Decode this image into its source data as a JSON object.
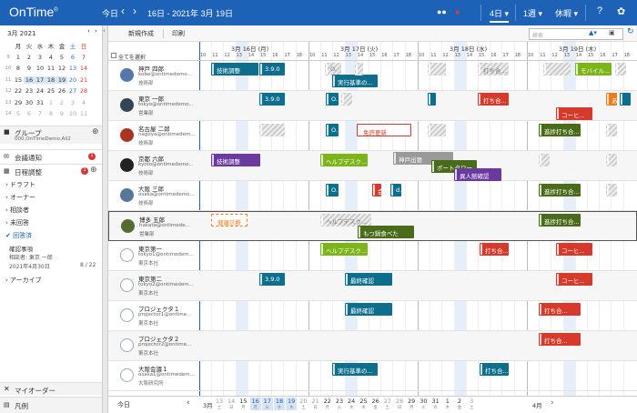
{
  "app": {
    "logo": "OnTime",
    "reg": "®"
  },
  "topbar": {
    "today": "今日",
    "prev": "‹",
    "next": "›",
    "date": "16日 - 2021年 3月 19日",
    "days": "4日",
    "week": "1週",
    "rest": "休暇",
    "help": "?",
    "gear": "✿"
  },
  "toolbar": {
    "new": "新規作成",
    "print": "印刷",
    "search_placeholder": "検索"
  },
  "calendar": {
    "title": "3月 2021",
    "weekdays": [
      "月",
      "火",
      "水",
      "木",
      "金",
      "土",
      "日"
    ],
    "rows": [
      {
        "wk": "9",
        "d": [
          "1",
          "2",
          "3",
          "4",
          "5",
          "6",
          "7"
        ]
      },
      {
        "wk": "10",
        "d": [
          "8",
          "9",
          "10",
          "11",
          "12",
          "13",
          "14"
        ]
      },
      {
        "wk": "11",
        "d": [
          "15",
          "16",
          "17",
          "18",
          "19",
          "20",
          "21"
        ]
      },
      {
        "wk": "12",
        "d": [
          "22",
          "23",
          "24",
          "25",
          "26",
          "27",
          "28"
        ]
      },
      {
        "wk": "13",
        "d": [
          "29",
          "30",
          "31",
          "1",
          "2",
          "3",
          "4"
        ]
      },
      {
        "wk": "14",
        "d": [
          "5",
          "6",
          "7",
          "8",
          "9",
          "10",
          "11"
        ]
      }
    ]
  },
  "left": {
    "group": "グループ",
    "group_sub": "000.OnTimeDemo.All2",
    "notice": "会議通知",
    "notice_badge": "1",
    "schedule": "日程調整",
    "schedule_badge": "1",
    "draft": "ドラフト",
    "owner": "オーナー",
    "consult": "相談者",
    "unanswered": "未回答",
    "answered": "回答済",
    "confirm": "確認事項",
    "consult_by": "相談者: 東京 一郎",
    "confirm_date": "2021年4月30日",
    "confirm_count": "8 / 22",
    "archive": "アーカイブ",
    "my_order": "マイオーダー",
    "legend": "凡例"
  },
  "grid": {
    "select_all": "全てを選択",
    "days": [
      "3月 16日 (月)",
      "3月 17日 (火)",
      "3月 18日 (水)",
      "3月 19日 (木)"
    ],
    "hours": [
      "10",
      "11",
      "12",
      "13",
      "14",
      "15",
      "16",
      "17",
      "18"
    ]
  },
  "people": [
    {
      "name": "神戸 四郎",
      "mail": "kobe@ontimedemo...",
      "dept": "技術部"
    },
    {
      "name": "東京 一郎",
      "mail": "tokyo@ontimedemo...",
      "dept": "営業部"
    },
    {
      "name": "名古屋 二郎",
      "mail": "nagoya@ontimedem...",
      "dept": "技術部"
    },
    {
      "name": "京都 六郎",
      "mail": "kyoto@ontimedemo...",
      "dept": "技術部"
    },
    {
      "name": "大阪 三郎",
      "mail": "osaka@ontimedemo...",
      "dept": "技術部"
    },
    {
      "name": "博多 五郎",
      "mail": "hakata@ontimede...",
      "dept": "営業部"
    },
    {
      "name": "東京第一",
      "mail": "tokyo1@ontimedem...",
      "dept": "東京本社"
    },
    {
      "name": "東京第二",
      "mail": "tokyo2@ontimedem...",
      "dept": "東京本社"
    },
    {
      "name": "プロジェクタ１",
      "mail": "projector1@ontime...",
      "dept": "東京本社"
    },
    {
      "name": "プロジェクタ２",
      "mail": "projector2@ontime...",
      "dept": "東京本社"
    },
    {
      "name": "大阪会議１",
      "mail": "osaka1@ontimedem...",
      "dept": "大阪研究所"
    }
  ],
  "events": {
    "e1": "技術調整",
    "e2": "3.9.0",
    "e3": "O.",
    "e4": "実行基準の...",
    "e5": "打ち合...",
    "e6": "モバイル...",
    "e7": "3.9.0",
    "e8": "O.",
    "e9": "打ち合...",
    "e10": "コーヒ...",
    "e11": "あ",
    "e12": "免許更新",
    "e13": "O.",
    "e14": "進捗打ち合...",
    "e15": "技術調整",
    "e16": "ヘルプデスク...",
    "e17": "神戸出張",
    "e18": "ポートタワー...",
    "e19": "異人館確認",
    "e20": "会",
    "e21": "d.",
    "e22": "O.",
    "e23": "進捗打ち合...",
    "e24": "健康診断",
    "e25": "ヘルプデスク...",
    "e26": "もつ鍋食べた",
    "e27": "進捗打ち合...",
    "e28": "ヘルプデスク...",
    "e29": "打ち合...",
    "e30": "コーヒ...",
    "e31": "3.9.0",
    "e32": "最終確認",
    "e33": "コーヒ...",
    "e34": "最終確認",
    "e35": "打ち合...",
    "e36": "打ち合...",
    "e37": "実行基準の...",
    "e38": "打ち合..."
  },
  "bottom": {
    "today": "今日",
    "month1": "3月",
    "month2": "4月",
    "dates": [
      {
        "d": "13",
        "w": "土"
      },
      {
        "d": "14",
        "w": "日"
      },
      {
        "d": "15",
        "w": "月"
      },
      {
        "d": "16",
        "w": "月"
      },
      {
        "d": "17",
        "w": "火"
      },
      {
        "d": "18",
        "w": "水"
      },
      {
        "d": "19",
        "w": "木"
      },
      {
        "d": "20",
        "w": "土"
      },
      {
        "d": "21",
        "w": "日"
      },
      {
        "d": "22",
        "w": "月"
      },
      {
        "d": "23",
        "w": "火"
      },
      {
        "d": "24",
        "w": "水"
      },
      {
        "d": "25",
        "w": "木"
      },
      {
        "d": "26",
        "w": "金"
      },
      {
        "d": "27",
        "w": "土"
      },
      {
        "d": "28",
        "w": "日"
      },
      {
        "d": "29",
        "w": "月"
      },
      {
        "d": "30",
        "w": "火"
      },
      {
        "d": "31",
        "w": "水"
      },
      {
        "d": "1",
        "w": "木"
      },
      {
        "d": "2",
        "w": "金"
      },
      {
        "d": "3",
        "w": "土"
      }
    ]
  }
}
